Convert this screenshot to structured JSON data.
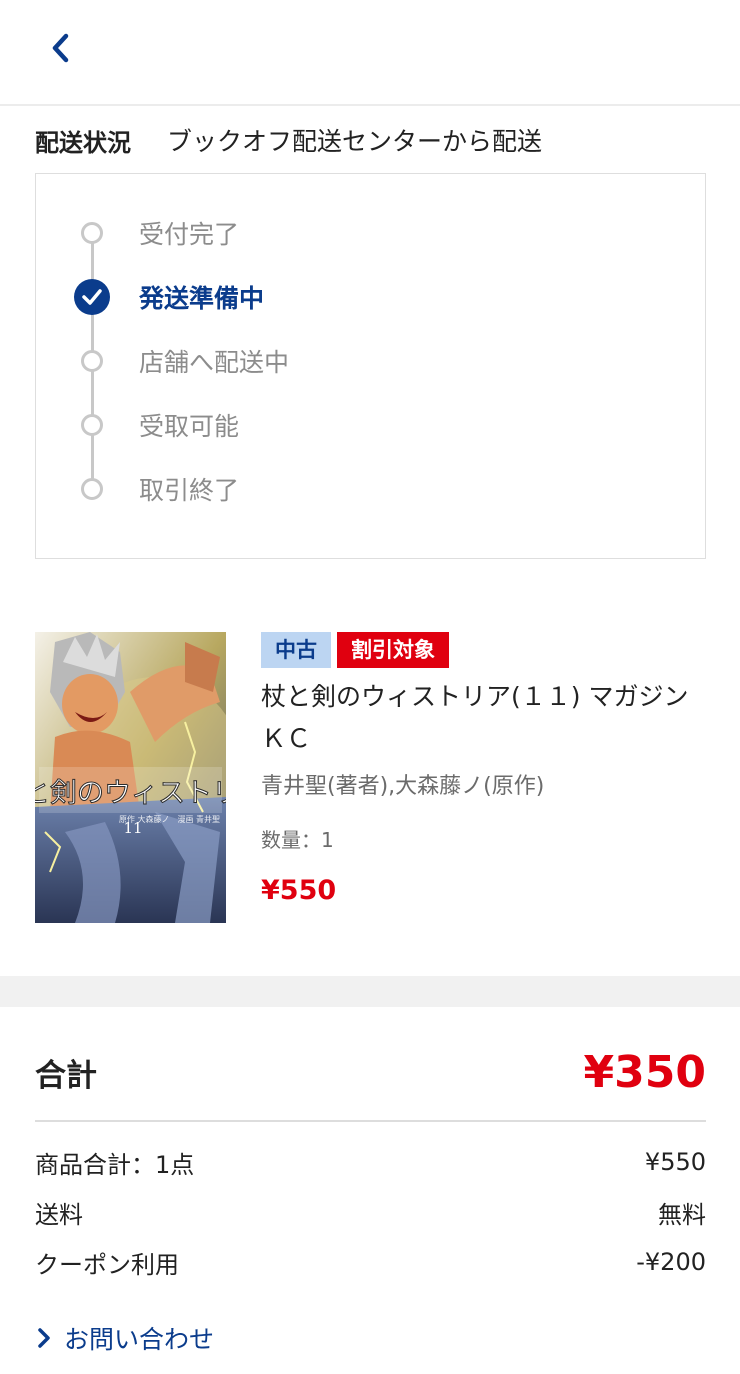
{
  "header": {
    "back_icon": "chevron-left-icon"
  },
  "shipping": {
    "label": "配送状況",
    "value": "ブックオフ配送センターから配送"
  },
  "steps": [
    {
      "label": "受付完了",
      "state": "pending"
    },
    {
      "label": "発送準備中",
      "state": "current"
    },
    {
      "label": "店舗へ配送中",
      "state": "pending"
    },
    {
      "label": "受取可能",
      "state": "pending"
    },
    {
      "label": "取引終了",
      "state": "pending"
    }
  ],
  "product": {
    "badge_used": "中古",
    "badge_discount": "割引対象",
    "title": "杖と剣のウィストリア(１１) マガジンＫＣ",
    "author": "青井聖(著者),大森藤ノ(原作)",
    "quantity": "数量：1",
    "price": "¥550",
    "cover_title": "杖と剣のウィストリア",
    "cover_volume": "11",
    "cover_credits": "原作 大森藤ノ　漫画 青井聖"
  },
  "summary": {
    "total_label": "合計",
    "total_value": "¥350",
    "rows": [
      {
        "label": "商品合計：1点",
        "value": "¥550"
      },
      {
        "label": "送料",
        "value": "無料"
      },
      {
        "label": "クーポン利用",
        "value": "-¥200"
      }
    ]
  },
  "inquiry": {
    "label": "お問い合わせ"
  },
  "colors": {
    "accent_blue": "#0b3c8c",
    "price_red": "#e0000f",
    "badge_used_bg": "#bcd5f2"
  }
}
